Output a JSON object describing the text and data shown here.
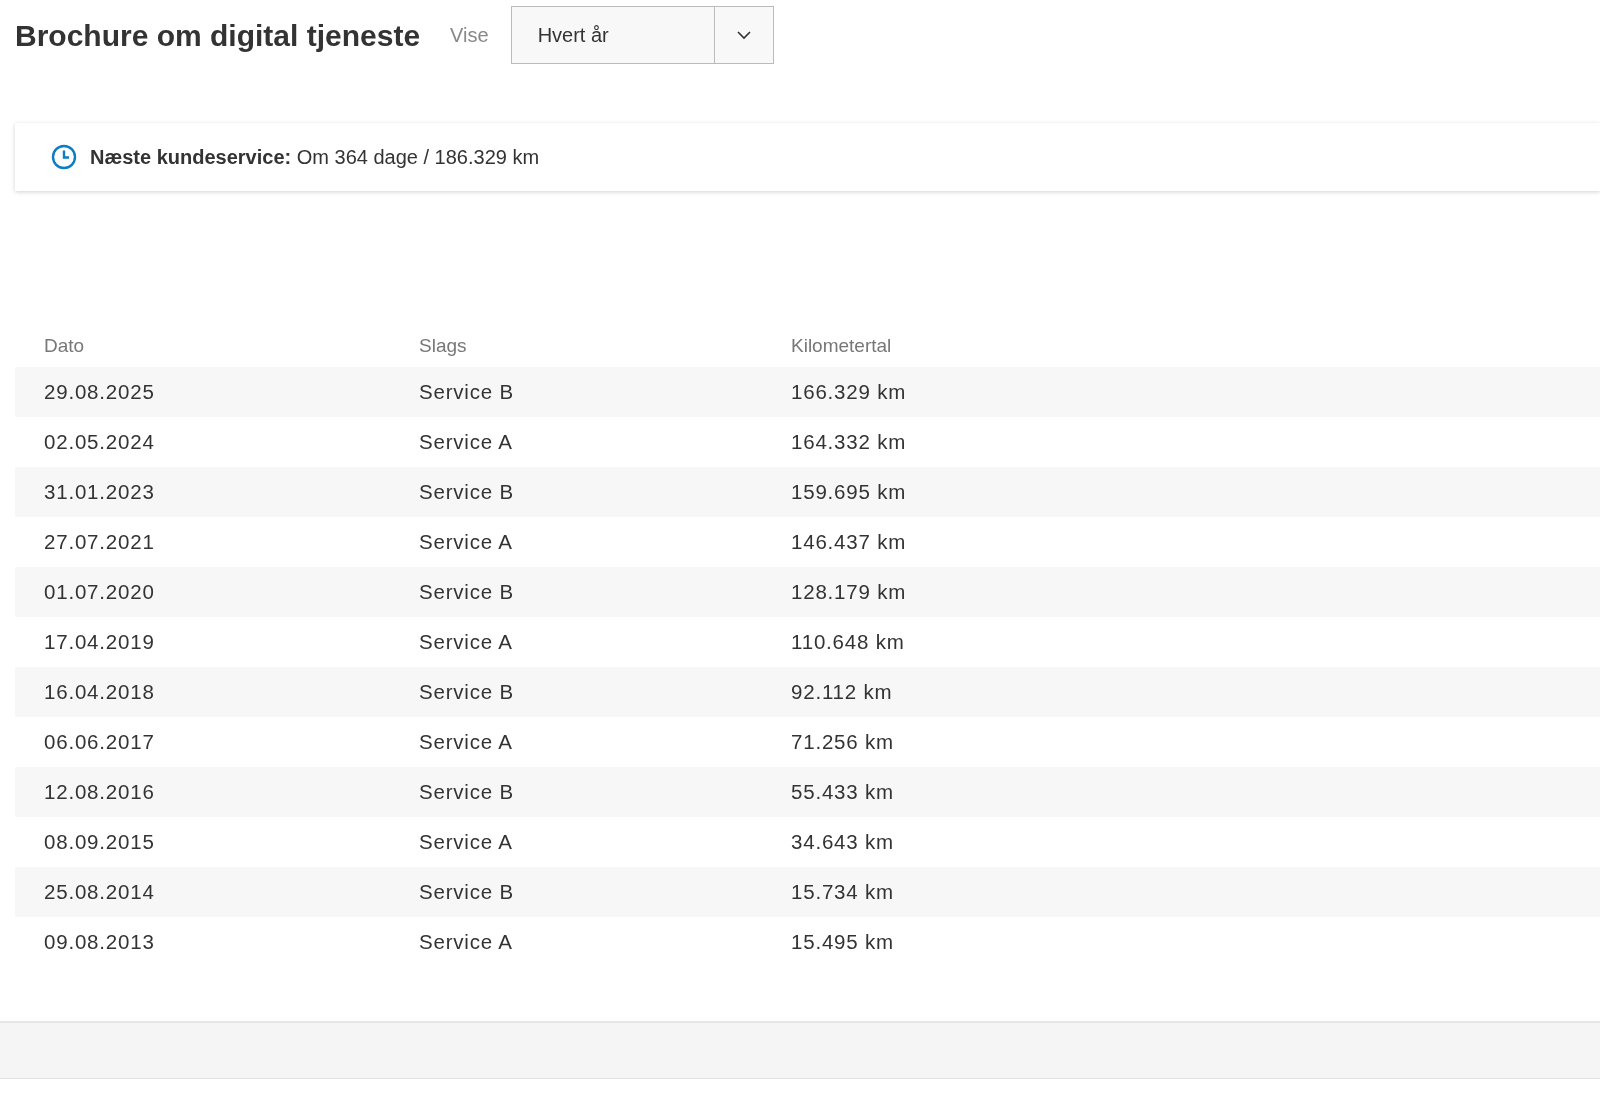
{
  "header": {
    "title": "Brochure om digital tjeneste",
    "view_label": "Vise",
    "view_select": {
      "value": "Hvert år"
    }
  },
  "next_service": {
    "text": "**Næste kundeservice:** Om 364 dage / 186.329 km"
  },
  "table": {
    "columns": [
      "Dato",
      "Slags",
      "Kilometertal"
    ],
    "rows": [
      [
        "29.08.2025",
        "Service B",
        "166.329 km"
      ],
      [
        "02.05.2024",
        "Service A",
        "164.332 km"
      ],
      [
        "31.01.2023",
        "Service B",
        "159.695 km"
      ],
      [
        "27.07.2021",
        "Service A",
        "146.437 km"
      ],
      [
        "01.07.2020",
        "Service B",
        "128.179 km"
      ],
      [
        "17.04.2019",
        "Service A",
        "110.648 km"
      ],
      [
        "16.04.2018",
        "Service B",
        "92.112 km"
      ],
      [
        "06.06.2017",
        "Service A",
        "71.256 km"
      ],
      [
        "12.08.2016",
        "Service B",
        "55.433 km"
      ],
      [
        "08.09.2015",
        "Service A",
        "34.643 km"
      ],
      [
        "25.08.2014",
        "Service B",
        "15.734 km"
      ],
      [
        "09.08.2013",
        "Service A",
        "15.495 km"
      ]
    ]
  }
}
